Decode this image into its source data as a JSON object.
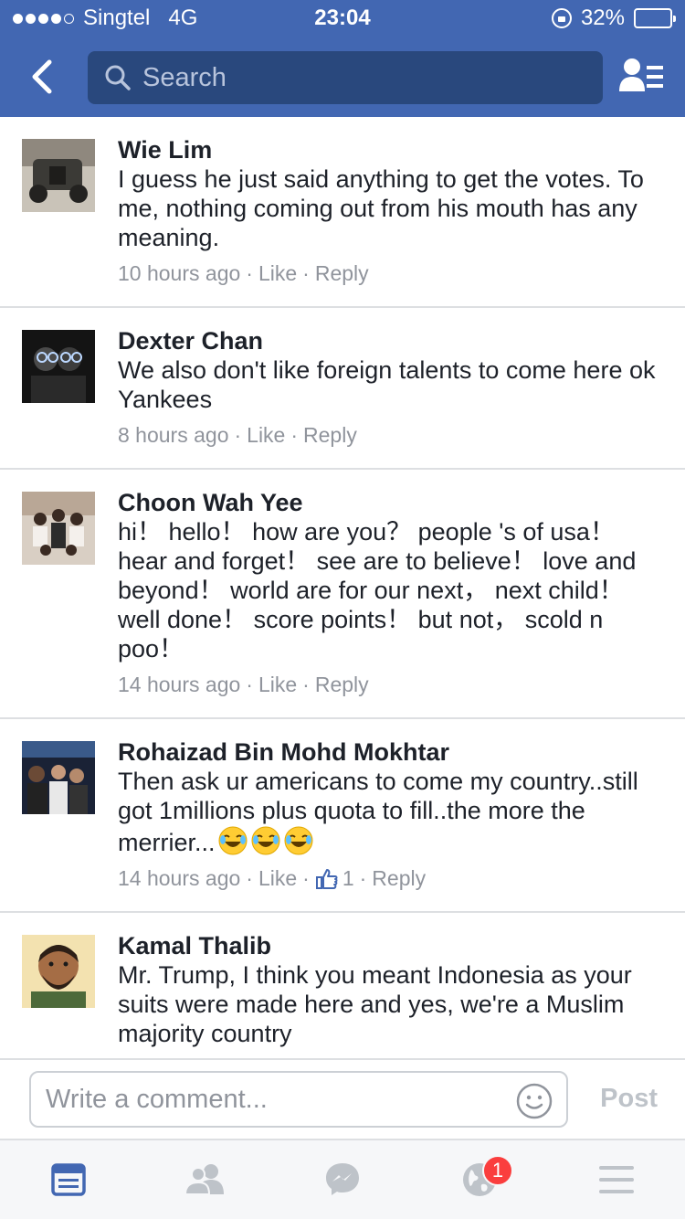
{
  "status_bar": {
    "carrier": "Singtel",
    "network": "4G",
    "time": "23:04",
    "battery_text": "32%",
    "battery_level": 0.32,
    "signal_bars": 4
  },
  "nav": {
    "search_placeholder": "Search",
    "back_icon": "chevron-left-icon",
    "right_icon": "friends-list-icon"
  },
  "comments": [
    {
      "author": "Wie Lim",
      "text": "I guess he just said anything to get the votes. To me, nothing coming out from his mouth has any meaning.",
      "time": "10 hours ago",
      "like_label": "Like",
      "reply_label": "Reply"
    },
    {
      "author": "Dexter Chan",
      "text": "We also don't like foreign talents to come here ok Yankees",
      "time": "8 hours ago",
      "like_label": "Like",
      "reply_label": "Reply"
    },
    {
      "author": "Choon Wah Yee",
      "text": "hi！ hello！ how are you？ people 's of usa！ hear and forget！ see are to believe！ love and beyond！ world are for our next， next child！ well done！ score points！ but not， scold n poo！",
      "time": "14 hours ago",
      "like_label": "Like",
      "reply_label": "Reply"
    },
    {
      "author": "Rohaizad Bin Mohd Mokhtar",
      "text": "Then ask ur americans to come my country..still got 1millions plus quota to fill..the more the merrier...",
      "emoji_count": 3,
      "time": "14 hours ago",
      "like_label": "Like",
      "like_count": "1",
      "reply_label": "Reply"
    },
    {
      "author": "Kamal Thalib",
      "text": "Mr. Trump, I think you meant Indonesia as your suits were made here and yes, we're a Muslim majority country"
    }
  ],
  "composer": {
    "placeholder": "Write a comment...",
    "post_label": "Post"
  },
  "tabbar": {
    "notifications_badge": "1",
    "accent": "#4267b2"
  },
  "colors": {
    "brand_blue": "#4267b2",
    "search_bg": "#29487d",
    "meta_gray": "#90949c",
    "badge_red": "#fa3e3e"
  }
}
